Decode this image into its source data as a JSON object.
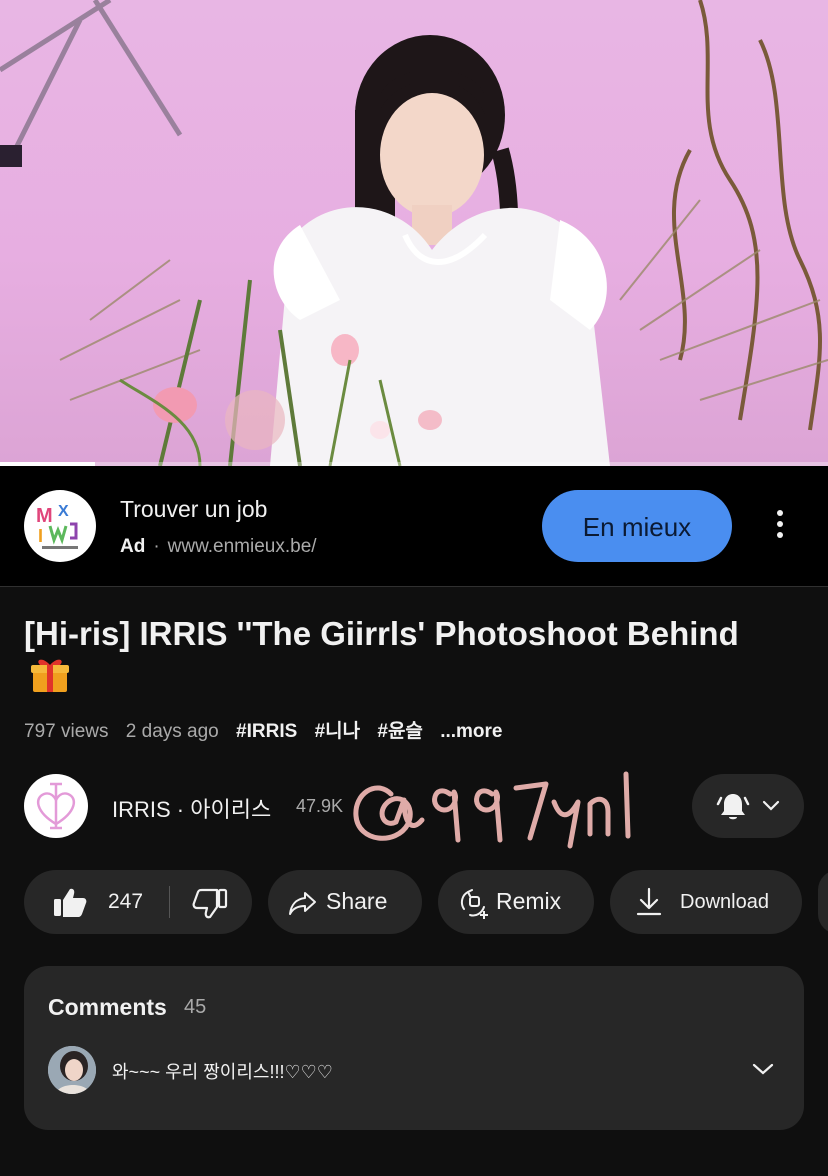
{
  "video": {
    "progress_fraction": 0.115
  },
  "ad": {
    "title": "Trouver un job",
    "badge": "Ad",
    "separator": "·",
    "url": "www.enmieux.be/",
    "cta_label": "En mieux",
    "brand_color": "#4a8ef0"
  },
  "video_title": "[Hi-ris] IRRIS ''The Giirrls' Photoshoot Behind",
  "title_emoji": "gift-icon",
  "meta": {
    "views": "797 views",
    "age": "2 days ago",
    "tags": [
      "#IRRIS",
      "#니나",
      "#윤슬"
    ],
    "more": "...more"
  },
  "channel": {
    "name": "IRRIS · 아이리스",
    "subscribers": "47.9K"
  },
  "watermark": "@997ynl",
  "actions": {
    "like_count": "247",
    "share_label": "Share",
    "remix_label": "Remix",
    "download_label": "Download"
  },
  "comments": {
    "heading": "Comments",
    "count": "45",
    "top_comment": "와~~~ 우리 짱이리스!!!♡♡♡"
  }
}
